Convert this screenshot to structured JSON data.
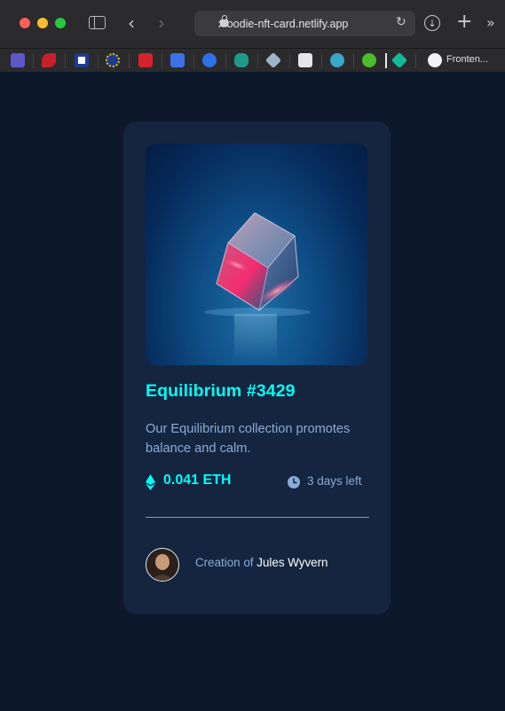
{
  "browser": {
    "url": "xfoodie-nft-card.netlify.app",
    "bookmark_label": "Fronten..."
  },
  "card": {
    "title": "Equilibrium #3429",
    "description": "Our Equilibrium collection promotes balance and calm.",
    "price": "0.041 ETH",
    "time_left": "3 days left",
    "creation_prefix": "Creation of",
    "creator_name": "Jules Wyvern"
  },
  "icons": {
    "price": "ethereum-icon",
    "time": "clock-icon",
    "avatar": "creator-avatar"
  },
  "colors": {
    "page_bg": "#0d192b",
    "card_bg": "#15253f",
    "accent_cyan": "#00fff8",
    "soft_blue": "#8bacd9",
    "white": "#ffffff"
  }
}
